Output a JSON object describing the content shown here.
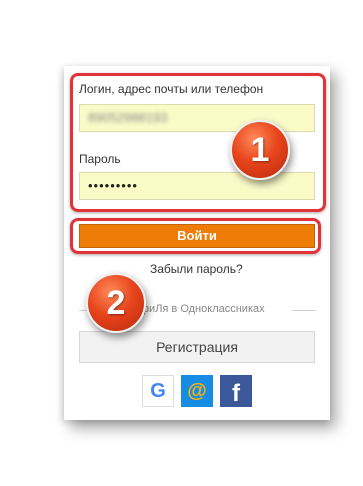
{
  "login": {
    "login_label": "Логин, адрес почты или телефон",
    "login_value": "89052988193",
    "password_label": "Пароль",
    "password_value": "•••••••••",
    "submit_label": "Войти",
    "forgot_label": "Забыли пароль?"
  },
  "separator": {
    "text": "фиЛя в Одноклассниках"
  },
  "register": {
    "label": "Регистрация"
  },
  "social": {
    "google": "G",
    "mail": "@",
    "facebook": "f"
  },
  "annotations": {
    "step1": "1",
    "step2": "2"
  },
  "colors": {
    "accent_orange": "#ee7d07",
    "highlight_red": "#e0343a",
    "field_yellow": "#fbfbc8"
  }
}
